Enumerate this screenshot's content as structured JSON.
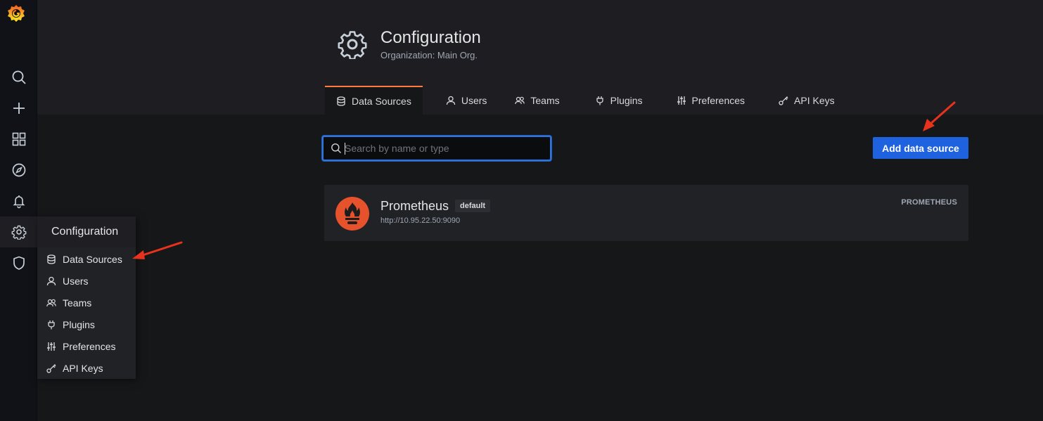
{
  "colors": {
    "accent_tab": "#ff7941",
    "primary_button": "#1f62e0",
    "prometheus": "#e6522c",
    "annotation_arrow": "#e8321e"
  },
  "sidebar": {
    "logo_icon": "grafana-logo-icon",
    "items": [
      {
        "icon": "search-icon"
      },
      {
        "icon": "plus-icon"
      },
      {
        "icon": "dashboards-icon"
      },
      {
        "icon": "explore-compass-icon"
      },
      {
        "icon": "alerting-bell-icon"
      },
      {
        "icon": "gear-icon"
      },
      {
        "icon": "shield-icon"
      }
    ]
  },
  "header": {
    "title": "Configuration",
    "subtitle": "Organization: Main Org.",
    "icon": "gear-icon"
  },
  "tabs": [
    {
      "label": "Data Sources",
      "icon": "database-icon",
      "active": true
    },
    {
      "label": "Users",
      "icon": "user-icon"
    },
    {
      "label": "Teams",
      "icon": "users-icon"
    },
    {
      "label": "Plugins",
      "icon": "plug-icon"
    },
    {
      "label": "Preferences",
      "icon": "sliders-icon"
    },
    {
      "label": "API Keys",
      "icon": "key-icon"
    }
  ],
  "toolbar": {
    "search_placeholder": "Search by name or type",
    "add_button": "Add data source"
  },
  "datasources": [
    {
      "name": "Prometheus",
      "badge": "default",
      "url": "http://10.95.22.50:9090",
      "type": "PROMETHEUS",
      "icon": "prometheus-logo-icon"
    }
  ],
  "flyout": {
    "title": "Configuration",
    "items": [
      {
        "label": "Data Sources",
        "icon": "database-icon"
      },
      {
        "label": "Users",
        "icon": "user-icon"
      },
      {
        "label": "Teams",
        "icon": "users-icon"
      },
      {
        "label": "Plugins",
        "icon": "plug-icon"
      },
      {
        "label": "Preferences",
        "icon": "sliders-icon"
      },
      {
        "label": "API Keys",
        "icon": "key-icon"
      }
    ]
  }
}
